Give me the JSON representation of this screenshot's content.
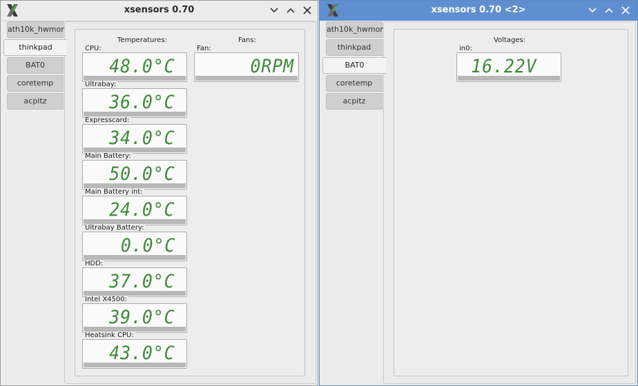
{
  "windows": [
    {
      "title": "xsensors 0.70",
      "tabs": [
        "ath10k_hwmon",
        "thinkpad",
        "BAT0",
        "coretemp",
        "acpitz"
      ],
      "active_tab": "thinkpad",
      "temperatures": {
        "label": "Temperatures:",
        "sensors": [
          {
            "name": "CPU:",
            "value": "48.0°C"
          },
          {
            "name": "Ultrabay:",
            "value": "36.0°C"
          },
          {
            "name": "Expresscard:",
            "value": "34.0°C"
          },
          {
            "name": "Main Battery:",
            "value": "50.0°C"
          },
          {
            "name": "Main Battery int:",
            "value": "24.0°C"
          },
          {
            "name": "Ultrabay Battery:",
            "value": "0.0°C"
          },
          {
            "name": "HDD:",
            "value": "37.0°C"
          },
          {
            "name": "Intel X4500:",
            "value": "39.0°C"
          },
          {
            "name": "Heatsink CPU:",
            "value": "43.0°C"
          }
        ]
      },
      "fans": {
        "label": "Fans:",
        "sensors": [
          {
            "name": "Fan:",
            "value": "0RPM"
          }
        ]
      }
    },
    {
      "title": "xsensors 0.70 <2>",
      "tabs": [
        "ath10k_hwmon",
        "thinkpad",
        "BAT0",
        "coretemp",
        "acpitz"
      ],
      "active_tab": "BAT0",
      "voltages": {
        "label": "Voltages:",
        "sensors": [
          {
            "name": "in0:",
            "value": "16.22V"
          }
        ]
      }
    }
  ],
  "colors": {
    "lcd_digits": "#3f8a39",
    "active_titlebar": "#5f8fd0"
  }
}
